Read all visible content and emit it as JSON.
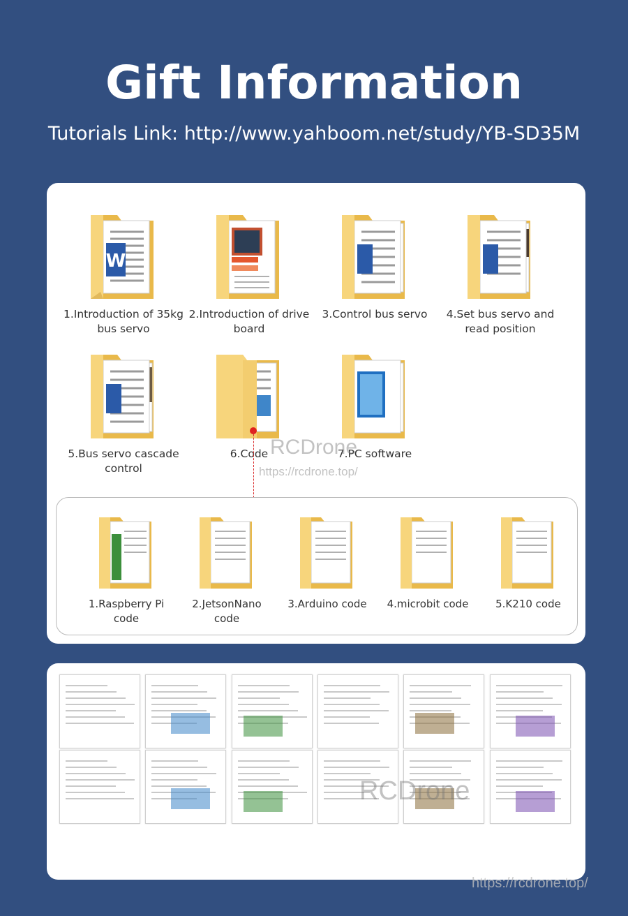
{
  "header": {
    "title": "Gift Information",
    "tutorial_link": "Tutorials Link: http://www.yahboom.net/study/YB-SD35M"
  },
  "folders": [
    {
      "label": "1.Introduction of 35kg bus servo",
      "icon": "word-doc-folder-icon"
    },
    {
      "label": "2.Introduction of drive board",
      "icon": "pdf-folder-icon"
    },
    {
      "label": "3.Control bus servo",
      "icon": "word-doc-folder-icon"
    },
    {
      "label": "4.Set bus servo and read position",
      "icon": "word-doc-folder-icon"
    },
    {
      "label": "5.Bus servo cascade control",
      "icon": "word-doc-folder-icon"
    },
    {
      "label": "6.Code",
      "icon": "code-folder-icon"
    },
    {
      "label": "7.PC software",
      "icon": "software-folder-icon"
    }
  ],
  "code_folders": [
    {
      "label": "1.Raspberry Pi code"
    },
    {
      "label": "2.JetsonNano code"
    },
    {
      "label": "3.Arduino code"
    },
    {
      "label": "4.microbit code"
    },
    {
      "label": "5.K210 code"
    }
  ],
  "watermarks": {
    "brand": "RCDrone",
    "url": "https://rcdrone.top/",
    "brand2": "RCDrone",
    "url2": "https://rcdrone.top/"
  },
  "colors": {
    "background": "#324f80",
    "card": "#ffffff",
    "folder": "#f7d57c",
    "accent_red": "#e0201e"
  }
}
